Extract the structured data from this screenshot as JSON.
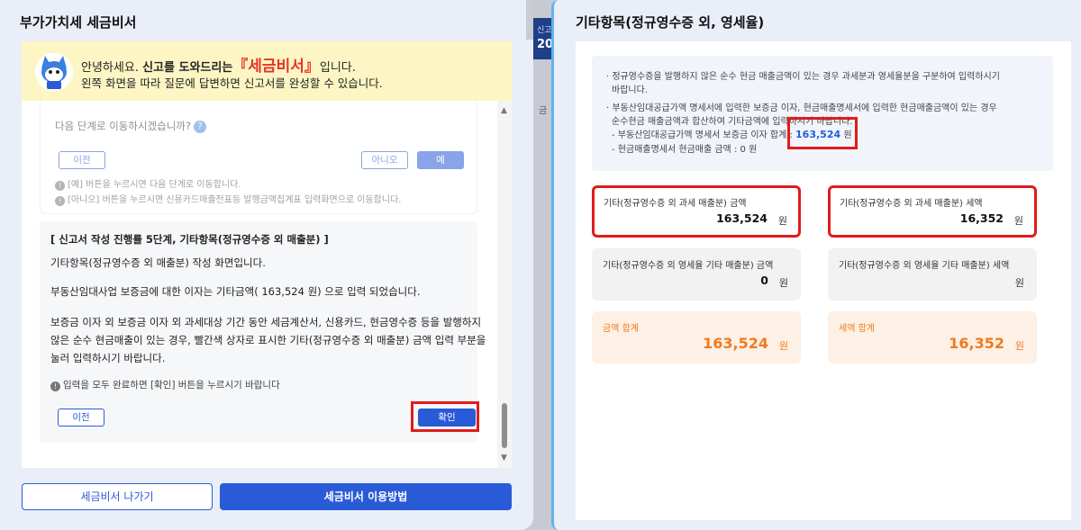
{
  "left_panel": {
    "title": "부가가치세 세금비서",
    "banner": {
      "line1_prefix": "안녕하세요. ",
      "line1_bold": "신고를 도와드리는",
      "line1_brand": "『세금비서』",
      "line1_suffix": "입니다.",
      "line2": "왼쪽 화면을 따라 질문에 답변하면 신고서를 완성할 수 있습니다."
    },
    "previous_step": {
      "question": "다음 단계로 이동하시겠습니까?",
      "help_icon_text": "?",
      "prev_label": "이전",
      "no_label": "아니오",
      "yes_label": "예",
      "note1": "[예] 버튼을 누르시면 다음 단계로 이동합니다.",
      "note2": "[아니오] 버튼을 누르시면 신용카드매출전표등 발행금액집계표 입력화면으로 이동합니다."
    },
    "current_step": {
      "heading": "[ 신고서 작성 진행률 5단계, 기타항목(정규영수증 외 매출분) ]",
      "line1": "기타항목(정규영수증 외 매출분) 작성 화면입니다.",
      "line2": "부동산임대사업 보증금에 대한 이자는 기타금액( 163,524 원) 으로 입력 되었습니다.",
      "line3": "보증금 이자 외 보증금 이자 외 과세대상 기간 동안 세금계산서, 신용카드, 현금영수증 등을 발행하지",
      "line4": "않은 순수 현금매출이 있는 경우, 빨간색 상자로 표시한 기타(정규영수증 외 매출분) 금액 입력 부분을",
      "line5": "눌러 입력하시기 바랍니다.",
      "note": "입력을 모두 완료하면 [확인] 버튼을 누르시기 바랍니다",
      "prev_label": "이전",
      "confirm_label": "확인"
    },
    "exit_label": "세금비서 나가기",
    "howto_label": "세금비서 이용방법"
  },
  "background": {
    "blue_frag1": "신고",
    "blue_frag2": "20",
    "frag": "금"
  },
  "right_panel": {
    "title": "기타항목(정규영수증 외, 영세율)",
    "info": {
      "bullet1": "· 정규영수증을 발행하지 않은 순수 현금 매출금액이 있는 경우 과세분과 영세율분을 구분하여 입력하시기",
      "bullet1_cont": "바랍니다.",
      "bullet2": "· 부동산임대공급가액 명세서에 입력한 보증금 이자, 현금매출명세서에 입력한 현금매출금액이 있는 경우",
      "bullet2_cont": "순수현금 매출금액과 합산하여 기타금액에 입력하시기 바랍니다.",
      "sub1_label": "- 부동산임대공급가액 명세서 보증금 이자 합계 : ",
      "sub1_value": "163,524",
      "sub1_unit": " 원",
      "sub2_label": "- 현금매출명세서 현금매출 금액",
      "sub2_value": ": 0 원"
    },
    "boxes": [
      {
        "label": "기타(정규영수증 외 과세 매출분) 금액",
        "value": "163,524",
        "unit": "원"
      },
      {
        "label": "기타(정규영수증 외 과세 매출분) 세액",
        "value": "16,352",
        "unit": "원"
      },
      {
        "label": "기타(정규영수증 외 영세율 기타 매출분) 금액",
        "value": "0",
        "unit": "원"
      },
      {
        "label": "기타(정규영수증 외 영세율 기타 매출분) 세액",
        "value": "",
        "unit": "원"
      },
      {
        "label": "금액 합계",
        "value": "163,524",
        "unit": "원"
      },
      {
        "label": "세액 합계",
        "value": "16,352",
        "unit": "원"
      }
    ]
  },
  "colors": {
    "primary_blue": "#2a5bd7",
    "highlight_red": "#e01c1c",
    "total_orange": "#f07a1f",
    "banner_yellow": "#fdf6c4"
  }
}
